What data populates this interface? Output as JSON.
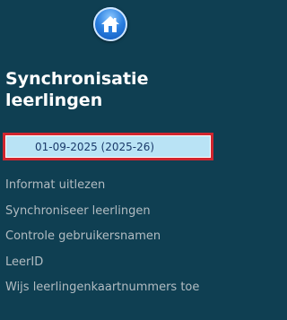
{
  "header": {
    "home_icon": "home-icon"
  },
  "page": {
    "title": "Synchronisatie leerlingen"
  },
  "period_select": {
    "value": "01-09-2025 (2025-26)"
  },
  "menu": {
    "items": [
      {
        "label": "Informat uitlezen"
      },
      {
        "label": "Synchroniseer leerlingen"
      },
      {
        "label": "Controle gebruikersnamen"
      },
      {
        "label": "LeerID"
      },
      {
        "label": "Wijs leerlingenkaartnummers toe"
      }
    ]
  },
  "colors": {
    "background": "#0f3f52",
    "title_text": "#ffffff",
    "menu_text": "#b2bcc2",
    "select_fill": "#b9e3f5",
    "select_border": "#d1262f"
  }
}
